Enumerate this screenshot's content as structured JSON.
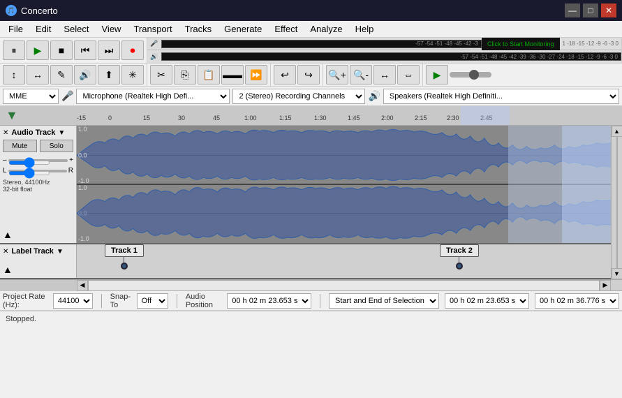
{
  "window": {
    "title": "Concerto",
    "icon": "🎵"
  },
  "titlebar": {
    "minimize": "—",
    "maximize": "□",
    "close": "✕"
  },
  "menu": {
    "items": [
      "File",
      "Edit",
      "Select",
      "View",
      "Transport",
      "Tracks",
      "Generate",
      "Effect",
      "Analyze",
      "Help"
    ]
  },
  "transport": {
    "pause": "⏸",
    "play": "▶",
    "stop": "■",
    "skipback": "⏮",
    "skipfwd": "⏭",
    "record": "⏺"
  },
  "toolbar": {
    "tools": [
      "↕",
      "↔",
      "✎",
      "🔊",
      "⬆",
      "*",
      "→"
    ],
    "zoom_in": "+",
    "zoom_out": "−",
    "fit_proj": "↔",
    "fit_sel": "↕",
    "undo": "↩",
    "redo": "↪"
  },
  "devices": {
    "host": "MME",
    "mic_label": "Microphone (Realtek High Defi...",
    "channels": "2 (Stereo) Recording Channels",
    "speaker_label": "Speakers (Realtek High Definiti..."
  },
  "timeline": {
    "markers": [
      "-15",
      "0",
      "15",
      "30",
      "45",
      "1:00",
      "1:15",
      "1:30",
      "1:45",
      "2:00",
      "2:15",
      "2:30",
      "2:45"
    ]
  },
  "audio_track": {
    "name": "Audio Track",
    "mute": "Mute",
    "solo": "Solo",
    "gain_label": "–",
    "gain_plus": "+",
    "pan_l": "L",
    "pan_r": "R",
    "info": "Stereo, 44100Hz\n32-bit float"
  },
  "label_track": {
    "name": "Label Track",
    "track1": "Track 1",
    "track2": "Track 2"
  },
  "bottom": {
    "project_rate_label": "Project Rate (Hz):",
    "project_rate": "44100",
    "snap_to_label": "Snap-To",
    "snap_to": "Off",
    "audio_position_label": "Audio Position",
    "audio_position": "0 0 h 0 2 m 2 3 . 6 5 3 s",
    "audio_position_val": "00 h 02 m 23.653 s",
    "selection_label": "Start and End of Selection",
    "selection_start": "00 h 02 m 23.653 s",
    "selection_end": "00 h 02 m 36.776 s",
    "status": "Stopped."
  },
  "vu": {
    "click_label": "Click to Start Monitoring",
    "top_scale": "-57 -54 -51 -48 -45 -42 -3",
    "bottom_scale": "-57 -54 -51 -48 -45 -42 -39 -36 -30 -27 -24 -18 -15 -12 -9 -6 -3 0"
  }
}
